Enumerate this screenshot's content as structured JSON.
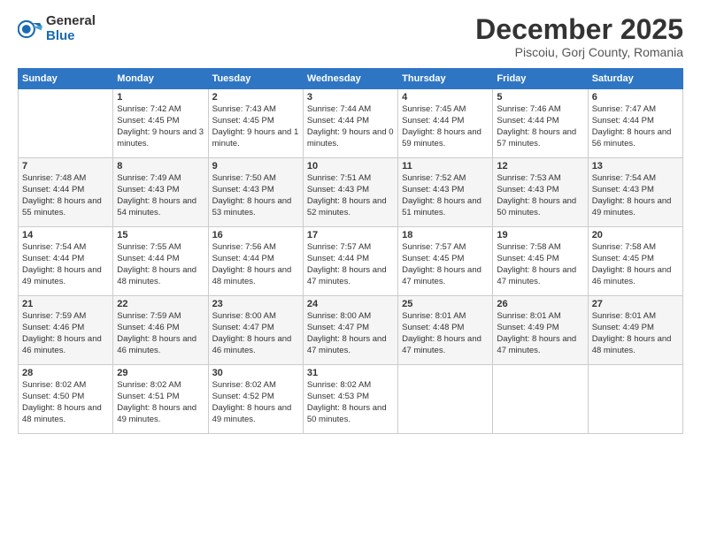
{
  "logo": {
    "general": "General",
    "blue": "Blue"
  },
  "title": "December 2025",
  "location": "Piscoiu, Gorj County, Romania",
  "weekdays": [
    "Sunday",
    "Monday",
    "Tuesday",
    "Wednesday",
    "Thursday",
    "Friday",
    "Saturday"
  ],
  "weeks": [
    [
      {
        "day": "",
        "sunrise": "",
        "sunset": "",
        "daylight": ""
      },
      {
        "day": "1",
        "sunrise": "Sunrise: 7:42 AM",
        "sunset": "Sunset: 4:45 PM",
        "daylight": "Daylight: 9 hours and 3 minutes."
      },
      {
        "day": "2",
        "sunrise": "Sunrise: 7:43 AM",
        "sunset": "Sunset: 4:45 PM",
        "daylight": "Daylight: 9 hours and 1 minute."
      },
      {
        "day": "3",
        "sunrise": "Sunrise: 7:44 AM",
        "sunset": "Sunset: 4:44 PM",
        "daylight": "Daylight: 9 hours and 0 minutes."
      },
      {
        "day": "4",
        "sunrise": "Sunrise: 7:45 AM",
        "sunset": "Sunset: 4:44 PM",
        "daylight": "Daylight: 8 hours and 59 minutes."
      },
      {
        "day": "5",
        "sunrise": "Sunrise: 7:46 AM",
        "sunset": "Sunset: 4:44 PM",
        "daylight": "Daylight: 8 hours and 57 minutes."
      },
      {
        "day": "6",
        "sunrise": "Sunrise: 7:47 AM",
        "sunset": "Sunset: 4:44 PM",
        "daylight": "Daylight: 8 hours and 56 minutes."
      }
    ],
    [
      {
        "day": "7",
        "sunrise": "Sunrise: 7:48 AM",
        "sunset": "Sunset: 4:44 PM",
        "daylight": "Daylight: 8 hours and 55 minutes."
      },
      {
        "day": "8",
        "sunrise": "Sunrise: 7:49 AM",
        "sunset": "Sunset: 4:43 PM",
        "daylight": "Daylight: 8 hours and 54 minutes."
      },
      {
        "day": "9",
        "sunrise": "Sunrise: 7:50 AM",
        "sunset": "Sunset: 4:43 PM",
        "daylight": "Daylight: 8 hours and 53 minutes."
      },
      {
        "day": "10",
        "sunrise": "Sunrise: 7:51 AM",
        "sunset": "Sunset: 4:43 PM",
        "daylight": "Daylight: 8 hours and 52 minutes."
      },
      {
        "day": "11",
        "sunrise": "Sunrise: 7:52 AM",
        "sunset": "Sunset: 4:43 PM",
        "daylight": "Daylight: 8 hours and 51 minutes."
      },
      {
        "day": "12",
        "sunrise": "Sunrise: 7:53 AM",
        "sunset": "Sunset: 4:43 PM",
        "daylight": "Daylight: 8 hours and 50 minutes."
      },
      {
        "day": "13",
        "sunrise": "Sunrise: 7:54 AM",
        "sunset": "Sunset: 4:43 PM",
        "daylight": "Daylight: 8 hours and 49 minutes."
      }
    ],
    [
      {
        "day": "14",
        "sunrise": "Sunrise: 7:54 AM",
        "sunset": "Sunset: 4:44 PM",
        "daylight": "Daylight: 8 hours and 49 minutes."
      },
      {
        "day": "15",
        "sunrise": "Sunrise: 7:55 AM",
        "sunset": "Sunset: 4:44 PM",
        "daylight": "Daylight: 8 hours and 48 minutes."
      },
      {
        "day": "16",
        "sunrise": "Sunrise: 7:56 AM",
        "sunset": "Sunset: 4:44 PM",
        "daylight": "Daylight: 8 hours and 48 minutes."
      },
      {
        "day": "17",
        "sunrise": "Sunrise: 7:57 AM",
        "sunset": "Sunset: 4:44 PM",
        "daylight": "Daylight: 8 hours and 47 minutes."
      },
      {
        "day": "18",
        "sunrise": "Sunrise: 7:57 AM",
        "sunset": "Sunset: 4:45 PM",
        "daylight": "Daylight: 8 hours and 47 minutes."
      },
      {
        "day": "19",
        "sunrise": "Sunrise: 7:58 AM",
        "sunset": "Sunset: 4:45 PM",
        "daylight": "Daylight: 8 hours and 47 minutes."
      },
      {
        "day": "20",
        "sunrise": "Sunrise: 7:58 AM",
        "sunset": "Sunset: 4:45 PM",
        "daylight": "Daylight: 8 hours and 46 minutes."
      }
    ],
    [
      {
        "day": "21",
        "sunrise": "Sunrise: 7:59 AM",
        "sunset": "Sunset: 4:46 PM",
        "daylight": "Daylight: 8 hours and 46 minutes."
      },
      {
        "day": "22",
        "sunrise": "Sunrise: 7:59 AM",
        "sunset": "Sunset: 4:46 PM",
        "daylight": "Daylight: 8 hours and 46 minutes."
      },
      {
        "day": "23",
        "sunrise": "Sunrise: 8:00 AM",
        "sunset": "Sunset: 4:47 PM",
        "daylight": "Daylight: 8 hours and 46 minutes."
      },
      {
        "day": "24",
        "sunrise": "Sunrise: 8:00 AM",
        "sunset": "Sunset: 4:47 PM",
        "daylight": "Daylight: 8 hours and 47 minutes."
      },
      {
        "day": "25",
        "sunrise": "Sunrise: 8:01 AM",
        "sunset": "Sunset: 4:48 PM",
        "daylight": "Daylight: 8 hours and 47 minutes."
      },
      {
        "day": "26",
        "sunrise": "Sunrise: 8:01 AM",
        "sunset": "Sunset: 4:49 PM",
        "daylight": "Daylight: 8 hours and 47 minutes."
      },
      {
        "day": "27",
        "sunrise": "Sunrise: 8:01 AM",
        "sunset": "Sunset: 4:49 PM",
        "daylight": "Daylight: 8 hours and 48 minutes."
      }
    ],
    [
      {
        "day": "28",
        "sunrise": "Sunrise: 8:02 AM",
        "sunset": "Sunset: 4:50 PM",
        "daylight": "Daylight: 8 hours and 48 minutes."
      },
      {
        "day": "29",
        "sunrise": "Sunrise: 8:02 AM",
        "sunset": "Sunset: 4:51 PM",
        "daylight": "Daylight: 8 hours and 49 minutes."
      },
      {
        "day": "30",
        "sunrise": "Sunrise: 8:02 AM",
        "sunset": "Sunset: 4:52 PM",
        "daylight": "Daylight: 8 hours and 49 minutes."
      },
      {
        "day": "31",
        "sunrise": "Sunrise: 8:02 AM",
        "sunset": "Sunset: 4:53 PM",
        "daylight": "Daylight: 8 hours and 50 minutes."
      },
      {
        "day": "",
        "sunrise": "",
        "sunset": "",
        "daylight": ""
      },
      {
        "day": "",
        "sunrise": "",
        "sunset": "",
        "daylight": ""
      },
      {
        "day": "",
        "sunrise": "",
        "sunset": "",
        "daylight": ""
      }
    ]
  ]
}
